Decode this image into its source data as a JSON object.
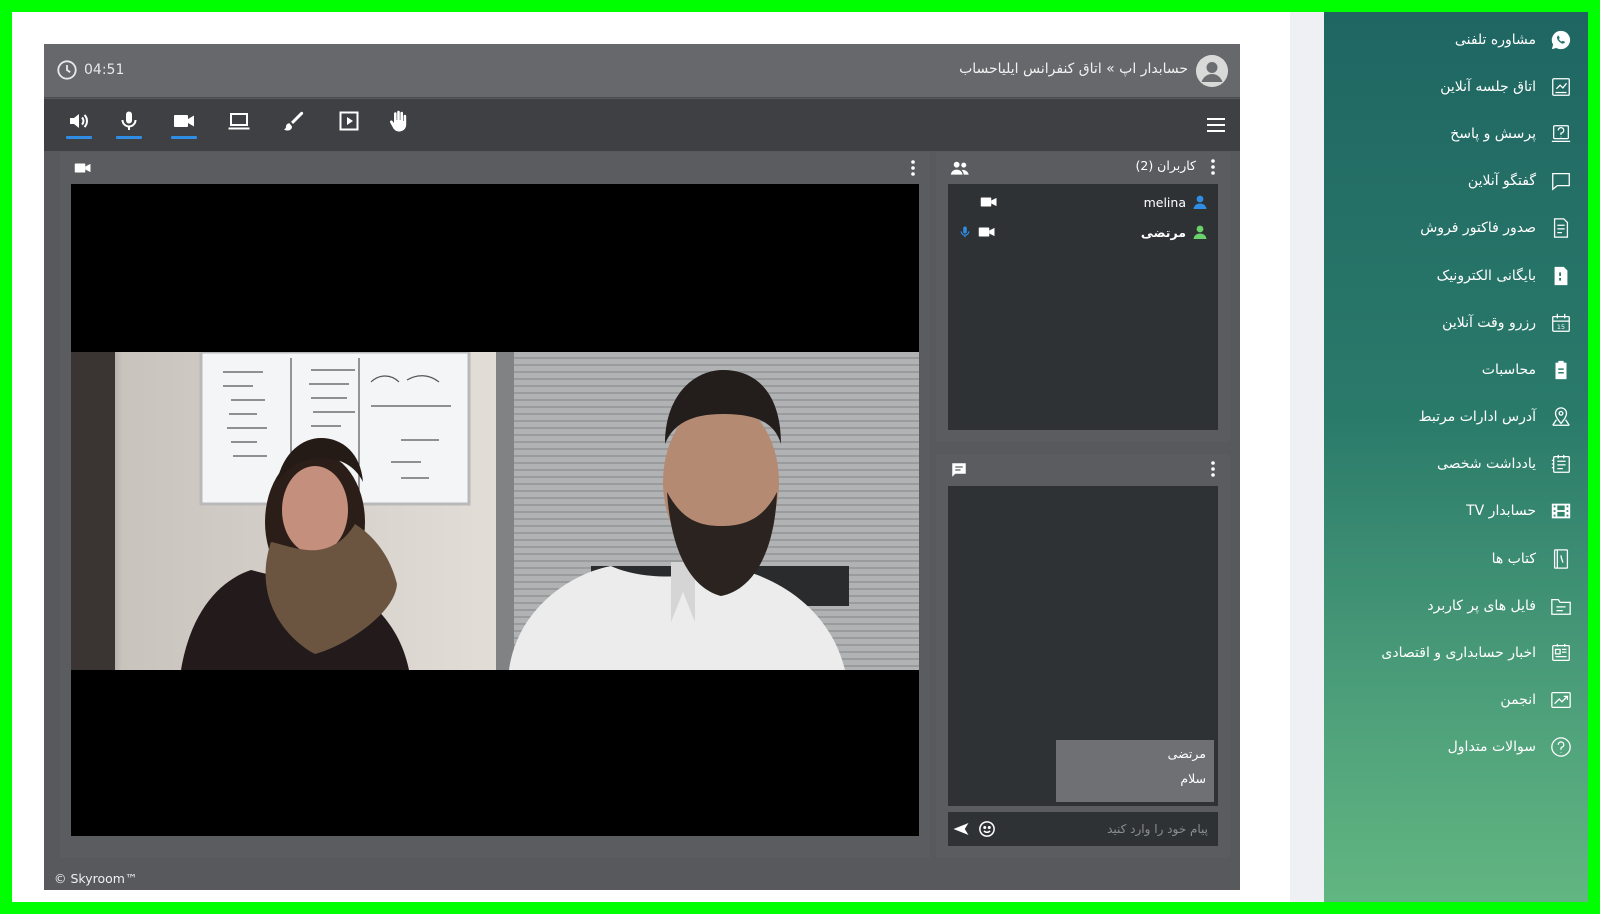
{
  "sidebar": {
    "items": [
      {
        "label": "مشاوره تلفنی",
        "icon": "whatsapp-icon"
      },
      {
        "label": "اتاق جلسه آنلاین",
        "icon": "meeting-room-icon"
      },
      {
        "label": "پرسش و پاسخ",
        "icon": "qa-icon"
      },
      {
        "label": "گفتگو آنلاین",
        "icon": "chat-icon"
      },
      {
        "label": "صدور فاکتور فروش",
        "icon": "invoice-icon"
      },
      {
        "label": "بایگانی الکترونیک",
        "icon": "archive-icon"
      },
      {
        "label": "رزرو وقت آنلاین",
        "icon": "calendar-icon"
      },
      {
        "label": "محاسبات",
        "icon": "clipboard-icon"
      },
      {
        "label": "آدرس ادارات مرتبط",
        "icon": "map-pin-icon"
      },
      {
        "label": "یادداشت شخصی",
        "icon": "notebook-icon"
      },
      {
        "label": "حسابدار TV",
        "icon": "film-icon"
      },
      {
        "label": "کتاب ها",
        "icon": "book-icon"
      },
      {
        "label": "فایل های پر کاربرد",
        "icon": "folder-icon"
      },
      {
        "label": "اخبار حسابداری و اقتصادی",
        "icon": "news-icon"
      },
      {
        "label": "انجمن",
        "icon": "chart-icon"
      },
      {
        "label": "سوالات متداول",
        "icon": "question-icon"
      }
    ]
  },
  "conference": {
    "room_title": "حسابدار اپ » اتاق کنفرانس ایلیاحساب",
    "timer": "04:51",
    "users_title": "کاربران (2)",
    "users": [
      {
        "name": "melina",
        "mic": false,
        "cam": true,
        "color": "#2f8de4"
      },
      {
        "name": "مرتضی",
        "mic": true,
        "cam": true,
        "color": "#6bd16b"
      }
    ],
    "chat": {
      "messages": [
        {
          "sender": "مرتضی",
          "text": "سلام"
        }
      ],
      "input_placeholder": "پیام خود را وارد کنید"
    },
    "footer": "© Skyroom™"
  },
  "colors": {
    "accent_blue": "#2f8de4",
    "user_green": "#6bd16b",
    "sidebar_top": "#1f6663",
    "sidebar_bottom": "#62b681"
  }
}
